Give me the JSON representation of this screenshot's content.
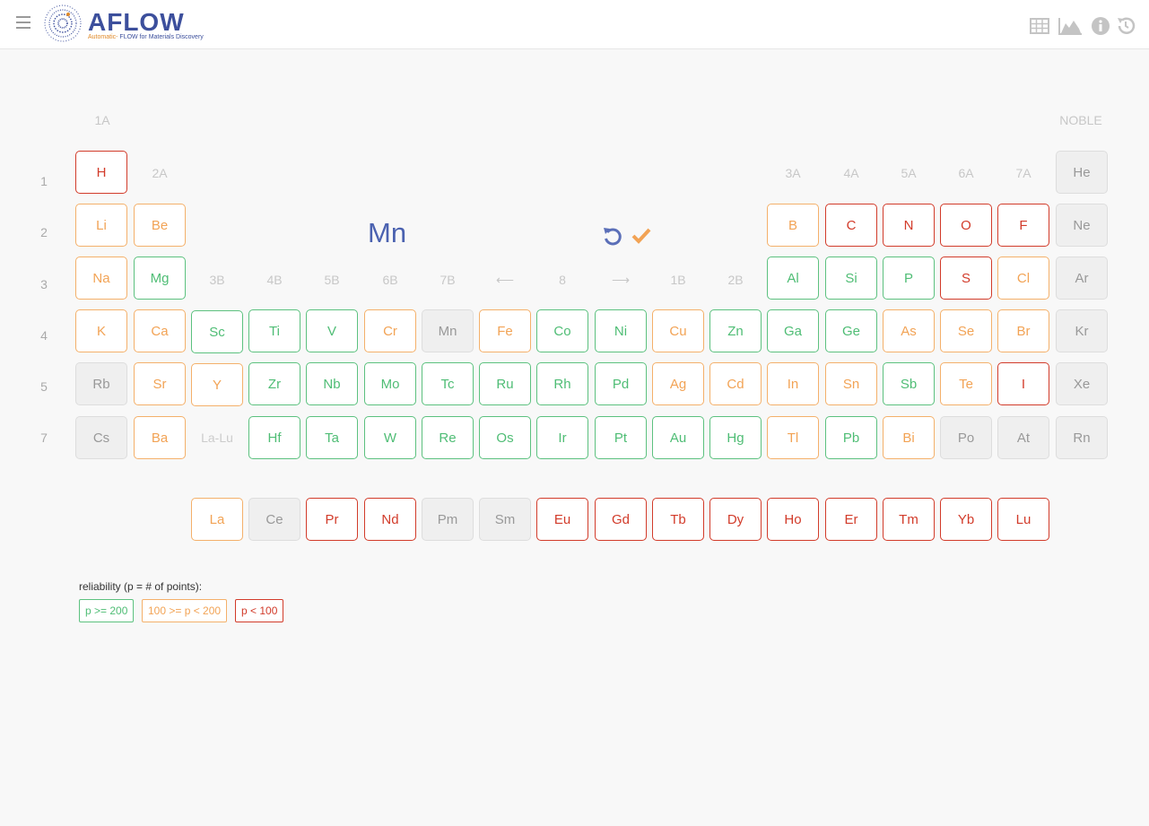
{
  "header": {
    "logo_word": "AFLOW",
    "tagline_prefix": "Automatic-",
    "tagline_rest": "FLOW for Materials Discovery",
    "tools": [
      "table-icon",
      "chart-icon",
      "info-icon",
      "history-icon"
    ]
  },
  "selection": {
    "element": "Mn"
  },
  "group_labels": {
    "1A": "1A",
    "2A": "2A",
    "3B": "3B",
    "4B": "4B",
    "5B": "5B",
    "6B": "6B",
    "7B": "7B",
    "arrow_left": "⟵",
    "eight": "8",
    "arrow_right": "⟶",
    "1B": "1B",
    "2B": "2B",
    "3A": "3A",
    "4A": "4A",
    "5A": "5A",
    "6A": "6A",
    "7A": "7A",
    "noble": "NOBLE"
  },
  "period_labels": [
    "1",
    "2",
    "3",
    "4",
    "5",
    "7"
  ],
  "lanthanide_placeholder": "La-Lu",
  "colors": {
    "green": "#4fbd75",
    "orange": "#f2a355",
    "red": "#d23b2a",
    "gray": "#999999",
    "selected": "#4b62b0"
  },
  "elements": {
    "H": "H",
    "He": "He",
    "Li": "Li",
    "Be": "Be",
    "B": "B",
    "C": "C",
    "N": "N",
    "O": "O",
    "F": "F",
    "Ne": "Ne",
    "Na": "Na",
    "Mg": "Mg",
    "Al": "Al",
    "Si": "Si",
    "P": "P",
    "S": "S",
    "Cl": "Cl",
    "Ar": "Ar",
    "K": "K",
    "Ca": "Ca",
    "Sc": "Sc",
    "Ti": "Ti",
    "V": "V",
    "Cr": "Cr",
    "Mn": "Mn",
    "Fe": "Fe",
    "Co": "Co",
    "Ni": "Ni",
    "Cu": "Cu",
    "Zn": "Zn",
    "Ga": "Ga",
    "Ge": "Ge",
    "As": "As",
    "Se": "Se",
    "Br": "Br",
    "Kr": "Kr",
    "Rb": "Rb",
    "Sr": "Sr",
    "Y": "Y",
    "Zr": "Zr",
    "Nb": "Nb",
    "Mo": "Mo",
    "Tc": "Tc",
    "Ru": "Ru",
    "Rh": "Rh",
    "Pd": "Pd",
    "Ag": "Ag",
    "Cd": "Cd",
    "In": "In",
    "Sn": "Sn",
    "Sb": "Sb",
    "Te": "Te",
    "I": "I",
    "Xe": "Xe",
    "Cs": "Cs",
    "Ba": "Ba",
    "Hf": "Hf",
    "Ta": "Ta",
    "W": "W",
    "Re": "Re",
    "Os": "Os",
    "Ir": "Ir",
    "Pt": "Pt",
    "Au": "Au",
    "Hg": "Hg",
    "Tl": "Tl",
    "Pb": "Pb",
    "Bi": "Bi",
    "Po": "Po",
    "At": "At",
    "Rn": "Rn",
    "La": "La",
    "Ce": "Ce",
    "Pr": "Pr",
    "Nd": "Nd",
    "Pm": "Pm",
    "Sm": "Sm",
    "Eu": "Eu",
    "Gd": "Gd",
    "Tb": "Tb",
    "Dy": "Dy",
    "Ho": "Ho",
    "Er": "Er",
    "Tm": "Tm",
    "Yb": "Yb",
    "Lu": "Lu"
  },
  "legend": {
    "title": "reliability (p = # of points):",
    "high": "p >= 200",
    "mid": "100 >= p < 200",
    "low": "p < 100"
  }
}
